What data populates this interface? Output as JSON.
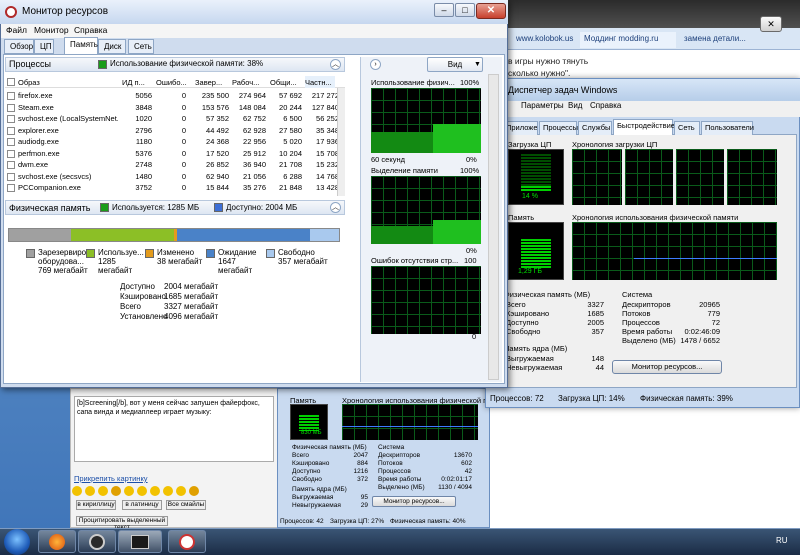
{
  "browser": {
    "tabs": [
      "www.kolobok.us",
      "Моддинг modding.ru",
      "замена детали..."
    ],
    "forum_lines": [
      "в игры нужно тянуть",
      "сколько нужно\"."
    ],
    "post_text": "[b]Screening[/b], вот у меня сейчас запушен файерфокс, сапа винда и медиаплеер играет музыку:",
    "attach_link": "Прикрепить картинку",
    "buttons": [
      "в кириллицу",
      "в латиницу",
      "Все смайлы"
    ],
    "quote_button": "Процитировать выделенный текст"
  },
  "rm": {
    "title": "Монитор ресурсов",
    "menu": [
      "Файл",
      "Монитор",
      "Справка"
    ],
    "tabs": [
      "Обзор",
      "ЦП",
      "Память",
      "Диск",
      "Сеть"
    ],
    "selected_tab": "Память",
    "processes": {
      "header": "Процессы",
      "legend": "Использование физической памяти: 38%",
      "columns": [
        "Образ",
        "ИД п...",
        "Ошибо...",
        "Завер...",
        "Рабоч...",
        "Общи...",
        "Частн..."
      ],
      "rows": [
        [
          "firefox.exe",
          "5056",
          "0",
          "235 500",
          "274 964",
          "57 692",
          "217 272"
        ],
        [
          "Steam.exe",
          "3848",
          "0",
          "153 576",
          "148 084",
          "20 244",
          "127 840"
        ],
        [
          "svchost.exe (LocalSystemNet...",
          "1020",
          "0",
          "57 352",
          "62 752",
          "6 500",
          "56 252"
        ],
        [
          "explorer.exe",
          "2796",
          "0",
          "44 492",
          "62 928",
          "27 580",
          "35 348"
        ],
        [
          "audiodg.exe",
          "1180",
          "0",
          "24 368",
          "22 956",
          "5 020",
          "17 936"
        ],
        [
          "perfmon.exe",
          "5376",
          "0",
          "17 520",
          "25 912",
          "10 204",
          "15 708"
        ],
        [
          "dwm.exe",
          "2748",
          "0",
          "26 852",
          "36 940",
          "21 708",
          "15 232"
        ],
        [
          "svchost.exe (secsvcs)",
          "1480",
          "0",
          "62 940",
          "21 056",
          "6 288",
          "14 768"
        ],
        [
          "PCCompanion.exe",
          "3752",
          "0",
          "15 844",
          "35 276",
          "21 848",
          "13 428"
        ]
      ]
    },
    "physical": {
      "header": "Физическая память",
      "used_legend": "Используется: 1285 МБ",
      "free_legend": "Доступно: 2004 МБ",
      "bar_fractions": {
        "reserved": 0.188,
        "used": 0.313,
        "modified": 0.009,
        "standby": 0.402,
        "free": 0.087
      },
      "categories": [
        {
          "name": "Зарезервиров оборудова...",
          "value": "769 мегабайт",
          "color": "#a0a0a0"
        },
        {
          "name": "Используе...",
          "value": "1285 мегабайт",
          "color": "#8cbf26"
        },
        {
          "name": "Изменено",
          "value": "38 мегабайт",
          "color": "#e39b1d"
        },
        {
          "name": "Ожидание",
          "value": "1647 мегабайт",
          "color": "#4a82c8"
        },
        {
          "name": "Свободно",
          "value": "357 мегабайт",
          "color": "#a9c9ee"
        }
      ],
      "summary_labels": [
        "Доступно",
        "Кэшировано",
        "Всего",
        "Установлено"
      ],
      "summary_values": [
        "2004 мегабайт",
        "1685 мегабайт",
        "3327 мегабайт",
        "4096 мегабайт"
      ]
    },
    "side": {
      "view_label": "Вид",
      "graphs": [
        {
          "title": "Использование физич...",
          "top": "100%",
          "bottom_left": "60 секунд",
          "bottom_right": "0%"
        },
        {
          "title": "Выделение памяти",
          "top": "100%",
          "bottom_right": "0%"
        },
        {
          "title": "Ошибок отсутствия стр...",
          "top": "100",
          "bottom_right": "0"
        }
      ]
    }
  },
  "tm2": {
    "title": "Диспетчер задач Windows",
    "menu": [
      "Параметры",
      "Вид",
      "Справка"
    ],
    "tabs": [
      "Приложения",
      "Процессы",
      "Службы",
      "Быстродействие",
      "Сеть",
      "Пользователи"
    ],
    "cpu_label": "Загрузка ЦП",
    "cpu_value": "14 %",
    "cpu_history": "Хронология загрузки ЦП",
    "mem_label": "Память",
    "mem_value": "1,29 ГБ",
    "mem_history": "Хронология использования физической памяти",
    "physical": {
      "title": "Физическая память (МБ)",
      "labels": [
        "Всего",
        "Кэшировано",
        "Доступно",
        "Свободно"
      ],
      "values": [
        "3327",
        "1685",
        "2005",
        "357"
      ]
    },
    "system": {
      "title": "Система",
      "labels": [
        "Дескрипторов",
        "Потоков",
        "Процессов",
        "Время работы",
        "Выделено (МБ)"
      ],
      "values": [
        "20965",
        "779",
        "72",
        "0:02:46:09",
        "1478 / 6652"
      ]
    },
    "kernel": {
      "title": "Память ядра (МБ)",
      "labels": [
        "Выгружаемая",
        "Невыгружаемая"
      ],
      "values": [
        "148",
        "44"
      ]
    },
    "rm_button": "Монитор ресурсов...",
    "status": [
      "Процессов: 72",
      "Загрузка ЦП: 14%",
      "Физическая память: 39%"
    ]
  },
  "tm3": {
    "mem_label": "Память",
    "mem_value": "830 МБ",
    "mem_history": "Хронология использования физической памяти",
    "physical": {
      "title": "Физическая память (МБ)",
      "labels": [
        "Всего",
        "Кэшировано",
        "Доступно",
        "Свободно"
      ],
      "values": [
        "2047",
        "884",
        "1216",
        "372"
      ]
    },
    "system": {
      "title": "Система",
      "labels": [
        "Дескрипторов",
        "Потоков",
        "Процессов",
        "Время работы",
        "Выделено (МБ)"
      ],
      "values": [
        "13670",
        "602",
        "42",
        "0:02:01:17",
        "1130 / 4094"
      ]
    },
    "kernel": {
      "title": "Память ядра (МБ)",
      "labels": [
        "Выгружаемая",
        "Невыгружаемая"
      ],
      "values": [
        "95",
        "29"
      ]
    },
    "rm_button": "Монитор ресурсов...",
    "status": [
      "Процессов: 42",
      "Загрузка ЦП: 27%",
      "Физическая память: 40%"
    ]
  },
  "taskbar": {
    "lang": "RU"
  }
}
